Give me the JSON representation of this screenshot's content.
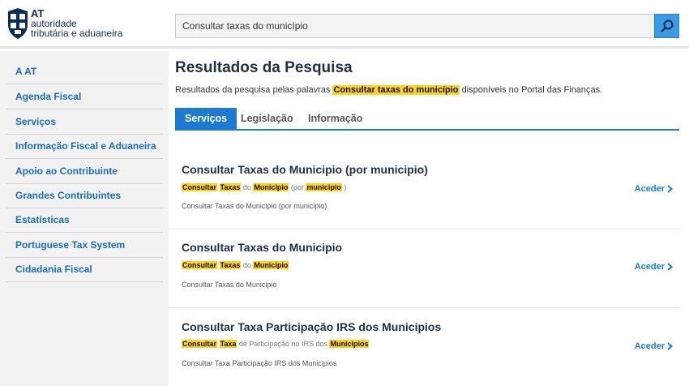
{
  "brand": {
    "at": "AT",
    "line1": "autoridade",
    "line2": "tributária e aduaneira"
  },
  "search": {
    "value": "Consultar taxas do município",
    "icon": "search-icon"
  },
  "sidebar": {
    "items": [
      {
        "label": "A AT"
      },
      {
        "label": "Agenda Fiscal"
      },
      {
        "label": "Serviços"
      },
      {
        "label": "Informação Fiscal e Aduaneira"
      },
      {
        "label": "Apoio ao Contribuinte"
      },
      {
        "label": "Grandes Contribuintes"
      },
      {
        "label": "Estatísticas"
      },
      {
        "label": "Portuguese Tax System"
      },
      {
        "label": "Cidadania Fiscal"
      }
    ]
  },
  "main": {
    "title": "Resultados da Pesquisa",
    "subtitle_pre": "Resultados da pesquisa pelas palavras",
    "subtitle_query": "Consultar taxas do município",
    "subtitle_post": "disponíveis no Portal das Finanças.",
    "tabs": [
      {
        "label": "Serviços",
        "active": true
      },
      {
        "label": "Legislação",
        "active": false
      },
      {
        "label": "Informação",
        "active": false
      }
    ],
    "results": [
      {
        "title": "Consultar Taxas do Municipio (por municipio)",
        "hl": [
          {
            "t": "Consultar",
            "m": true
          },
          {
            "t": " ",
            "m": false
          },
          {
            "t": "Taxas",
            "m": true
          },
          {
            "t": " do ",
            "m": false
          },
          {
            "t": "Municipio",
            "m": true
          },
          {
            "t": " (por ",
            "m": false
          },
          {
            "t": "municipio",
            "m": true
          },
          {
            "t": " )",
            "m": false
          }
        ],
        "desc": "Consultar Taxas do Municipio (por municipio)",
        "action": "Aceder"
      },
      {
        "title": "Consultar Taxas do Municipio",
        "hl": [
          {
            "t": "Consultar",
            "m": true
          },
          {
            "t": " ",
            "m": false
          },
          {
            "t": "Taxas",
            "m": true
          },
          {
            "t": " do ",
            "m": false
          },
          {
            "t": "Municipio",
            "m": true
          }
        ],
        "desc": "Consultar Taxas do Municipio",
        "action": "Aceder"
      },
      {
        "title": "Consultar Taxa Participação IRS dos Municipios",
        "hl": [
          {
            "t": "Consultar",
            "m": true
          },
          {
            "t": " ",
            "m": false
          },
          {
            "t": "Taxa",
            "m": true
          },
          {
            "t": " de Participação no IRS dos ",
            "m": false
          },
          {
            "t": "Municipios",
            "m": true
          }
        ],
        "desc": "Consultar Taxa Participação IRS dos Municipios",
        "action": "Aceder"
      }
    ]
  },
  "colors": {
    "accent": "#1c7bd0",
    "highlight": "#ffd21f",
    "sidebar_bg": "#f2f2f2",
    "brand_navy": "#0b2c5a"
  }
}
